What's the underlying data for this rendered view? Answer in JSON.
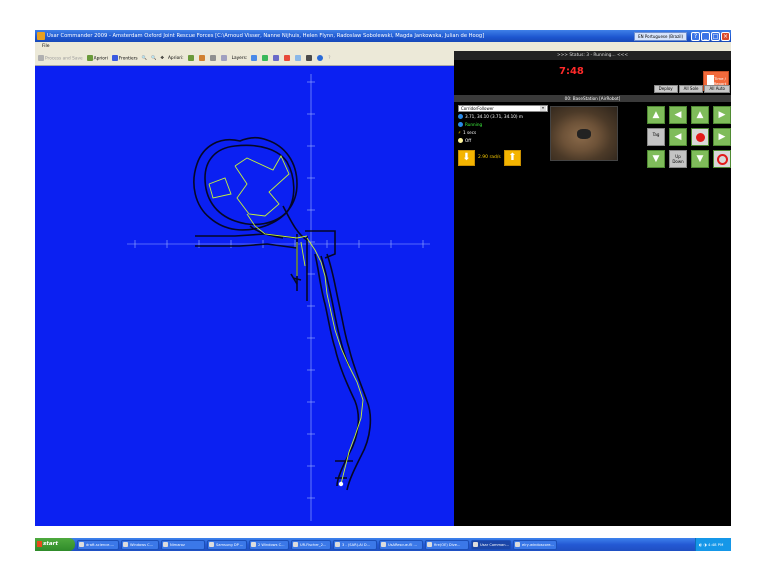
{
  "window": {
    "title": "Usar Commander 2009 - Amsterdam Oxford Joint Rescue Forces [C:\\Arnoud Visser, Nanne Nijhuis, Helen Flynn, Radoslaw Sobolewski, Magda Jankowska, Julian de Hoog]",
    "language_indicator": "EN Portuguese (Brazil)"
  },
  "menu": {
    "file": "File"
  },
  "toolbar": {
    "process_and_save": "Process and Save",
    "apriori": "Apriori",
    "frontiers": "Frontiers",
    "apriori2": "Apriori:",
    "layers": "Layers:"
  },
  "status": {
    "text": ">>> Status: 3 - Running... <<<"
  },
  "timer": {
    "value": "7:48"
  },
  "time_report_button": {
    "line1": "Time /",
    "line2": "Report"
  },
  "deploy": {
    "deploy": "Deploy",
    "all_sole": "All Sole",
    "all_auto": "All Auto"
  },
  "robot": {
    "header": "00: BaseStation [AirRobot]",
    "behavior": "CorridorFollower",
    "position": "3.71, 34.10 (3.71, 34.10) m",
    "state": "Running",
    "time": "1 secs",
    "light": "Off",
    "speed": "2.90 rad/s"
  },
  "controls": {
    "tag": "Tag",
    "up_down_1": "Up",
    "up_down_2": "Down"
  },
  "taskbar": {
    "start": "start",
    "tasks": [
      "draft-science-...",
      "Windows C...",
      "Nimaroz",
      "Samsung DP ...",
      "2 Windows C...",
      "UR-Fischer_2...",
      "3 - (SAR)-AI D...",
      "UsARescue-fll ...",
      "fire(OE) Dive...",
      "Usar Comman...",
      "elry-windoscore..."
    ],
    "clock": "4:48 PM"
  },
  "colors": {
    "map_background": "#0b20f2",
    "path": "#c6f23a",
    "walls": "#000000",
    "timer": "#ff2a2a"
  }
}
